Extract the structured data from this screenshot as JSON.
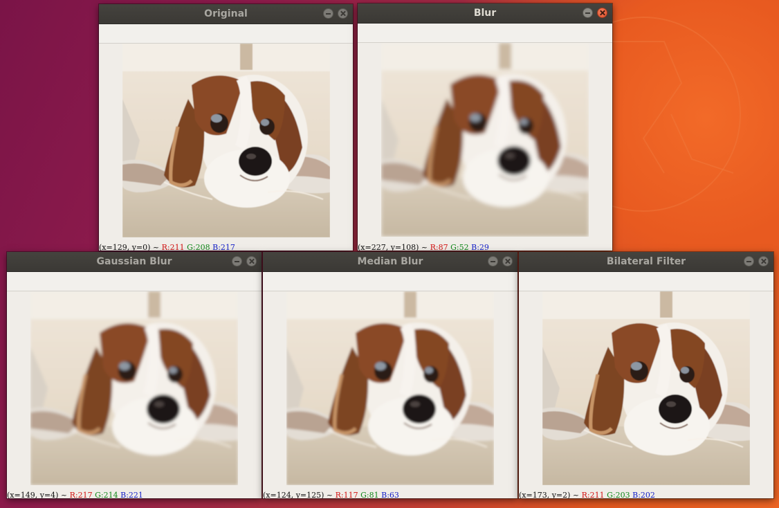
{
  "windows": [
    {
      "id": "original",
      "title": "Original",
      "status": {
        "coords": "(x=129, y=0) ~ ",
        "r": "R:211",
        "g": "G:208",
        "b": "B:217"
      }
    },
    {
      "id": "blur",
      "title": "Blur",
      "status": {
        "coords": "(x=227, y=108) ~ ",
        "r": "R:87",
        "g": "G:52",
        "b": "B:29"
      }
    },
    {
      "id": "gaussian",
      "title": "Gaussian Blur",
      "status": {
        "coords": "(x=149, y=4) ~ ",
        "r": "R:217",
        "g": "G:214",
        "b": "B:221"
      }
    },
    {
      "id": "median",
      "title": "Median Blur",
      "status": {
        "coords": "(x=124, y=125) ~ ",
        "r": "R:117",
        "g": "G:81",
        "b": "B:63"
      }
    },
    {
      "id": "bilateral",
      "title": "Bilateral Filter",
      "status": {
        "coords": "(x=173, y=2) ~ ",
        "r": "R:211",
        "g": "G:203",
        "b": "B:202"
      }
    }
  ],
  "icons": {
    "minimize": "minimize-icon",
    "close": "close-icon",
    "image": "dog-photo"
  },
  "colors": {
    "titlebar": "#3b3935",
    "window_bg": "#f0ede8",
    "close_active": "#e0502c",
    "status_r": "#d21313",
    "status_g": "#11881a",
    "status_b": "#1520c8"
  }
}
